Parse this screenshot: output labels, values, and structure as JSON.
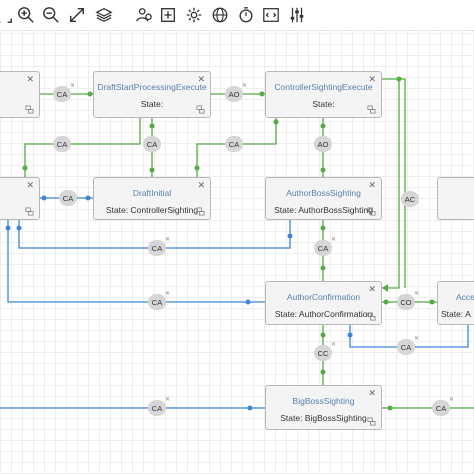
{
  "toolbar": {
    "icons": [
      "expand-icon",
      "zoom-in-icon",
      "zoom-out-icon",
      "fit-icon",
      "layers-icon",
      "users-icon",
      "add-box-icon",
      "gear-icon",
      "globe-icon",
      "timer-icon",
      "code-icon",
      "sliders-icon"
    ]
  },
  "nodes": {
    "left_top": {
      "title": "",
      "state": ""
    },
    "draft_start": {
      "title": "DraftStartProcessingExecute",
      "state": "State:"
    },
    "controller_sighting_execute": {
      "title": "ControllerSightingExecute",
      "state": "State:"
    },
    "left_mid": {
      "title": "",
      "state": ""
    },
    "draft_initial": {
      "title": "DraftInitial",
      "state": "State: ControllerSighting"
    },
    "author_boss_sighting": {
      "title": "AuthorBossSighting",
      "state": "State: AuthorBossSighting"
    },
    "right_mid": {
      "title": "",
      "state": ""
    },
    "author_confirmation": {
      "title": "AuthorConfirmation",
      "state": "State: AuthorConfirmation"
    },
    "accept_partial": {
      "title": "Acce",
      "state": "State: A"
    },
    "big_boss_sighting": {
      "title": "BigBossSighting",
      "state": "State: BigBossSighting"
    }
  },
  "edge_labels": [
    "CA",
    "AO",
    "CA",
    "CA",
    "AO",
    "CA",
    "AC",
    "CA",
    "CA",
    "CA",
    "CO",
    "CA",
    "CC",
    "CA",
    "CA"
  ],
  "colors": {
    "green": "#55aa44",
    "blue": "#3f84d6",
    "title": "#5a7fb0"
  }
}
